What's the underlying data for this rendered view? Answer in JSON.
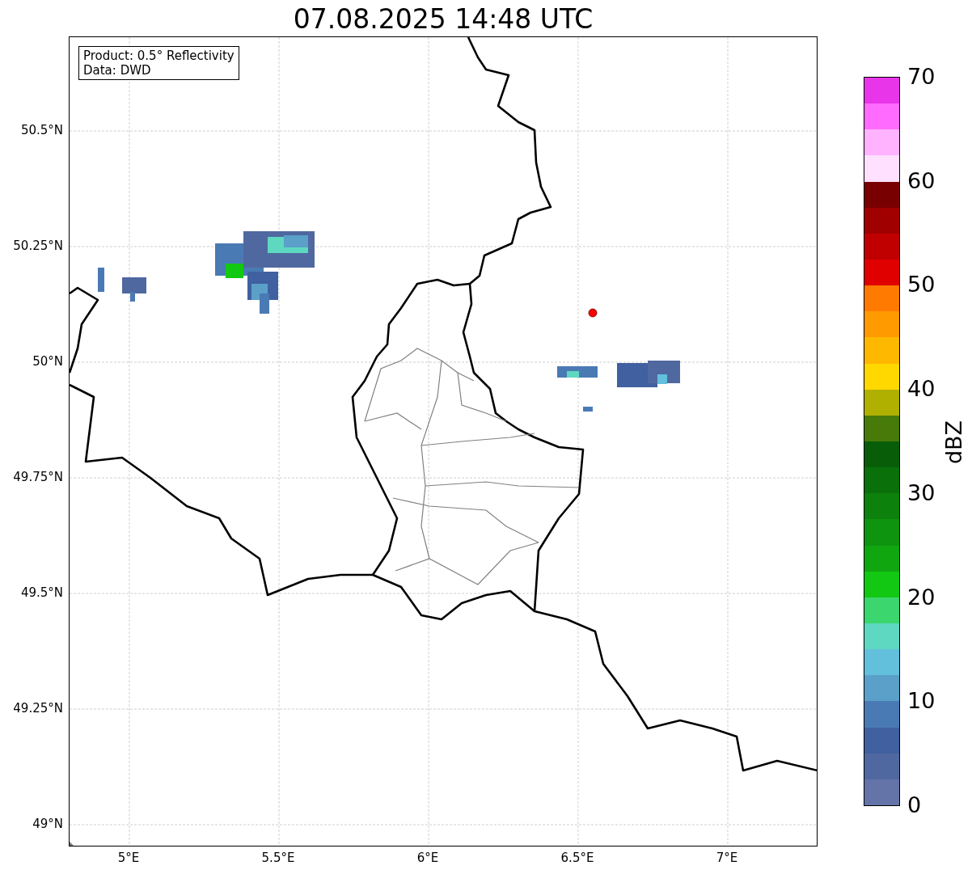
{
  "title": "07.08.2025 14:48 UTC",
  "map": {
    "info_box": [
      "Product: 0.5° Reflectivity",
      "Data: DWD"
    ],
    "x_ticks": [
      "5°E",
      "5.5°E",
      "6°E",
      "6.5°E",
      "7°E"
    ],
    "y_ticks": [
      "50.5°N",
      "50.25°N",
      "50°N",
      "49.75°N",
      "49.5°N",
      "49.25°N",
      "49°N"
    ]
  },
  "colorbar": {
    "label": "dBZ",
    "ticks": [
      "70",
      "60",
      "50",
      "40",
      "30",
      "20",
      "10",
      "0"
    ],
    "bands": [
      {
        "color": "#e935e9"
      },
      {
        "color": "#ff6bff"
      },
      {
        "color": "#ffb3ff"
      },
      {
        "color": "#ffe0ff"
      },
      {
        "color": "#780000"
      },
      {
        "color": "#a00000"
      },
      {
        "color": "#c00000"
      },
      {
        "color": "#e00000"
      },
      {
        "color": "#ff7a00"
      },
      {
        "color": "#ff9a00"
      },
      {
        "color": "#ffb800"
      },
      {
        "color": "#ffd800"
      },
      {
        "color": "#b0b000"
      },
      {
        "color": "#487a0a"
      },
      {
        "color": "#085e08"
      },
      {
        "color": "#0a700a"
      },
      {
        "color": "#0c820c"
      },
      {
        "color": "#0e940e"
      },
      {
        "color": "#10a610"
      },
      {
        "color": "#12c812"
      },
      {
        "color": "#3cd66e"
      },
      {
        "color": "#5ed8c0"
      },
      {
        "color": "#62c0dc"
      },
      {
        "color": "#5aa0c8"
      },
      {
        "color": "#4a7ab4"
      },
      {
        "color": "#4060a0"
      },
      {
        "color": "#5068a0"
      },
      {
        "color": "#6474a8"
      }
    ]
  }
}
